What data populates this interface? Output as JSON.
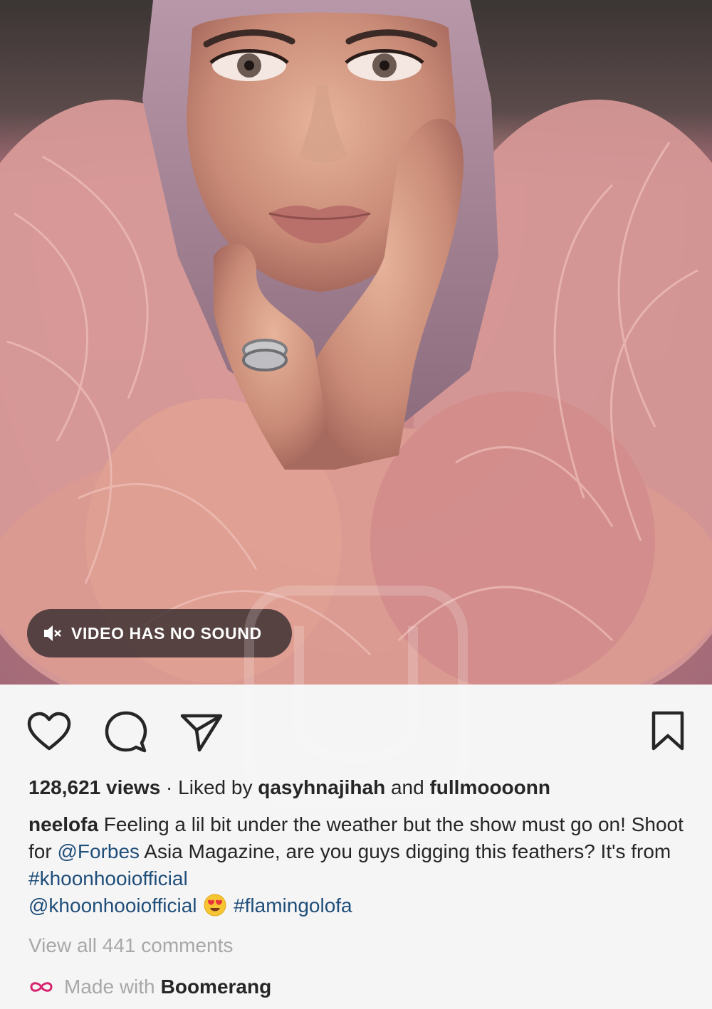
{
  "media": {
    "mute_icon": "speaker-muted-icon",
    "sound_notice": "VIDEO HAS NO SOUND"
  },
  "actions": {
    "like_icon": "heart-icon",
    "comment_icon": "comment-bubble-icon",
    "share_icon": "paper-plane-icon",
    "save_icon": "bookmark-icon"
  },
  "stats": {
    "views": "128,621 views",
    "separator": " · ",
    "liked_by_prefix": "Liked by ",
    "liked_user_1": "qasyhnajihah",
    "liked_and": " and ",
    "liked_user_2": "fullmoooonn"
  },
  "caption": {
    "username": "neelofa",
    "text_1": " Feeling a lil bit under the weather but the show must go on! Shoot for ",
    "mention_1": "@Forbes",
    "text_2": " Asia Magazine, are you guys digging this feathers? It's from ",
    "hashtag_1": "#khoonhooiofficial",
    "mention_2": "@khoonhooiofficial",
    "emoji": "heart-eyes-emoji",
    "hashtag_2": "#flamingolofa"
  },
  "comments": {
    "view_all": "View all 441 comments"
  },
  "boomerang": {
    "icon": "infinity-icon",
    "made_with": "Made with",
    "app_name": "Boomerang"
  },
  "colors": {
    "link": "#1f4e79",
    "muted_text": "#a8a8a8",
    "boomerang_accent": "#d6246e",
    "background": "#f6f5f6"
  }
}
